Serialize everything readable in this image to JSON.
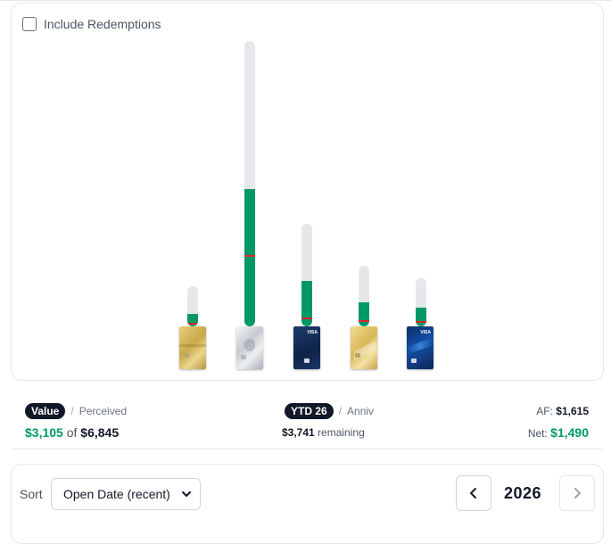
{
  "filters": {
    "include_redemptions_label": "Include Redemptions",
    "include_redemptions_checked": false
  },
  "cards": [
    {
      "name": "gold-card-1",
      "theme": "gold",
      "progress_pct": 31,
      "marker_pct": 90
    },
    {
      "name": "platinum-card",
      "theme": "platinum",
      "progress_pct": 48,
      "marker_pct": 75
    },
    {
      "name": "navy-visa-card",
      "theme": "navy",
      "progress_pct": 44,
      "marker_pct": 91
    },
    {
      "name": "gold-card-2",
      "theme": "lightgold",
      "progress_pct": 39,
      "marker_pct": 90
    },
    {
      "name": "blue-visa-card",
      "theme": "blue",
      "progress_pct": 38,
      "marker_pct": 88
    }
  ],
  "value_summary": {
    "active_toggle": "Value",
    "alt_toggle": "Perceived",
    "separator": "/",
    "earned": "$3,105",
    "of_label": "of",
    "total": "$6,845"
  },
  "period_summary": {
    "active_toggle": "YTD 26",
    "alt_toggle": "Anniv",
    "separator": "/",
    "remaining_amount": "$3,741",
    "remaining_label": "remaining"
  },
  "fees": {
    "af_label": "AF:",
    "af_value": "$1,615",
    "net_label": "Net:",
    "net_value": "$1,490"
  },
  "controls": {
    "sort_label": "Sort",
    "sort_selected": "Open Date (recent)",
    "year": "2026",
    "prev_icon": "chevron-left-icon",
    "next_icon": "chevron-right-icon"
  },
  "colors": {
    "accent": "#009966",
    "track": "#e5e7eb",
    "marker": "#dc2626",
    "pill": "#111827"
  }
}
